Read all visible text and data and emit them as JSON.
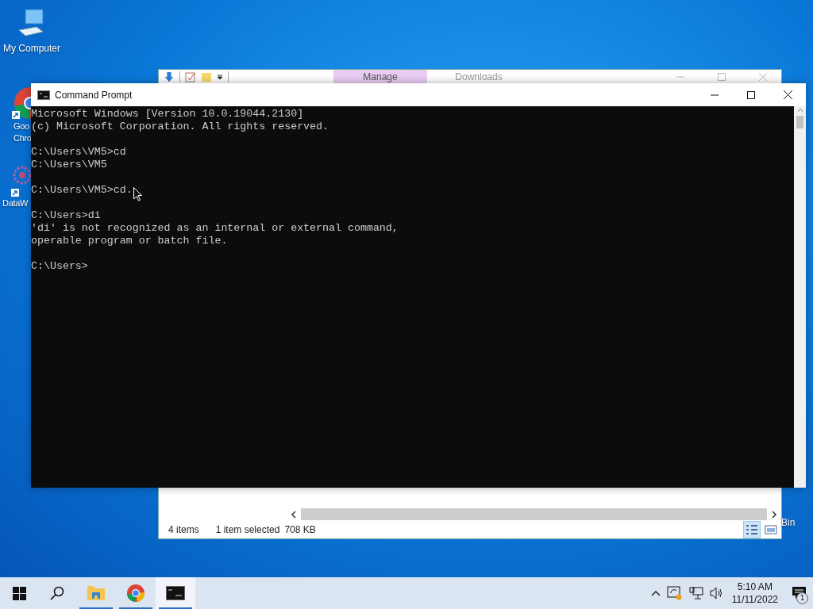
{
  "desktop": {
    "icons": [
      {
        "kind": "computer",
        "lines": [
          "My Computer"
        ]
      },
      {
        "kind": "browser",
        "lines": [
          "Goo",
          "Chro"
        ]
      },
      {
        "kind": "network",
        "lines": [
          "DataW"
        ]
      },
      {
        "kind": "bin",
        "lines": [
          "Bin"
        ]
      }
    ]
  },
  "explorer": {
    "tabs": [
      {
        "label": "Manage",
        "selected": true
      },
      {
        "label": "Downloads",
        "selected": false
      }
    ],
    "status_bar": {
      "item_count": "4 items",
      "selection": "1 item selected",
      "size": "708 KB"
    },
    "views": [
      {
        "kind": "details",
        "selected": true
      },
      {
        "kind": "large",
        "selected": false
      }
    ]
  },
  "cmd": {
    "title": "Command Prompt",
    "blocks": [
      [
        "Microsoft Windows [Version 10.0.19044.2130]",
        "(c) Microsoft Corporation. All rights reserved."
      ],
      [
        "C:\\Users\\VM5>cd",
        "C:\\Users\\VM5"
      ],
      [
        "C:\\Users\\VM5>cd."
      ],
      [
        "C:\\Users>di",
        "'di' is not recognized as an internal or external command,",
        "operable program or batch file."
      ],
      [
        "C:\\Users>"
      ]
    ]
  },
  "taskbar": {
    "apps": [
      {
        "kind": "folder",
        "open": true,
        "active": false
      },
      {
        "kind": "browser",
        "open": true,
        "active": false
      },
      {
        "kind": "terminal",
        "open": true,
        "active": true
      }
    ],
    "time": "5:10 AM",
    "date": "11/11/2022",
    "notifications": "1"
  }
}
